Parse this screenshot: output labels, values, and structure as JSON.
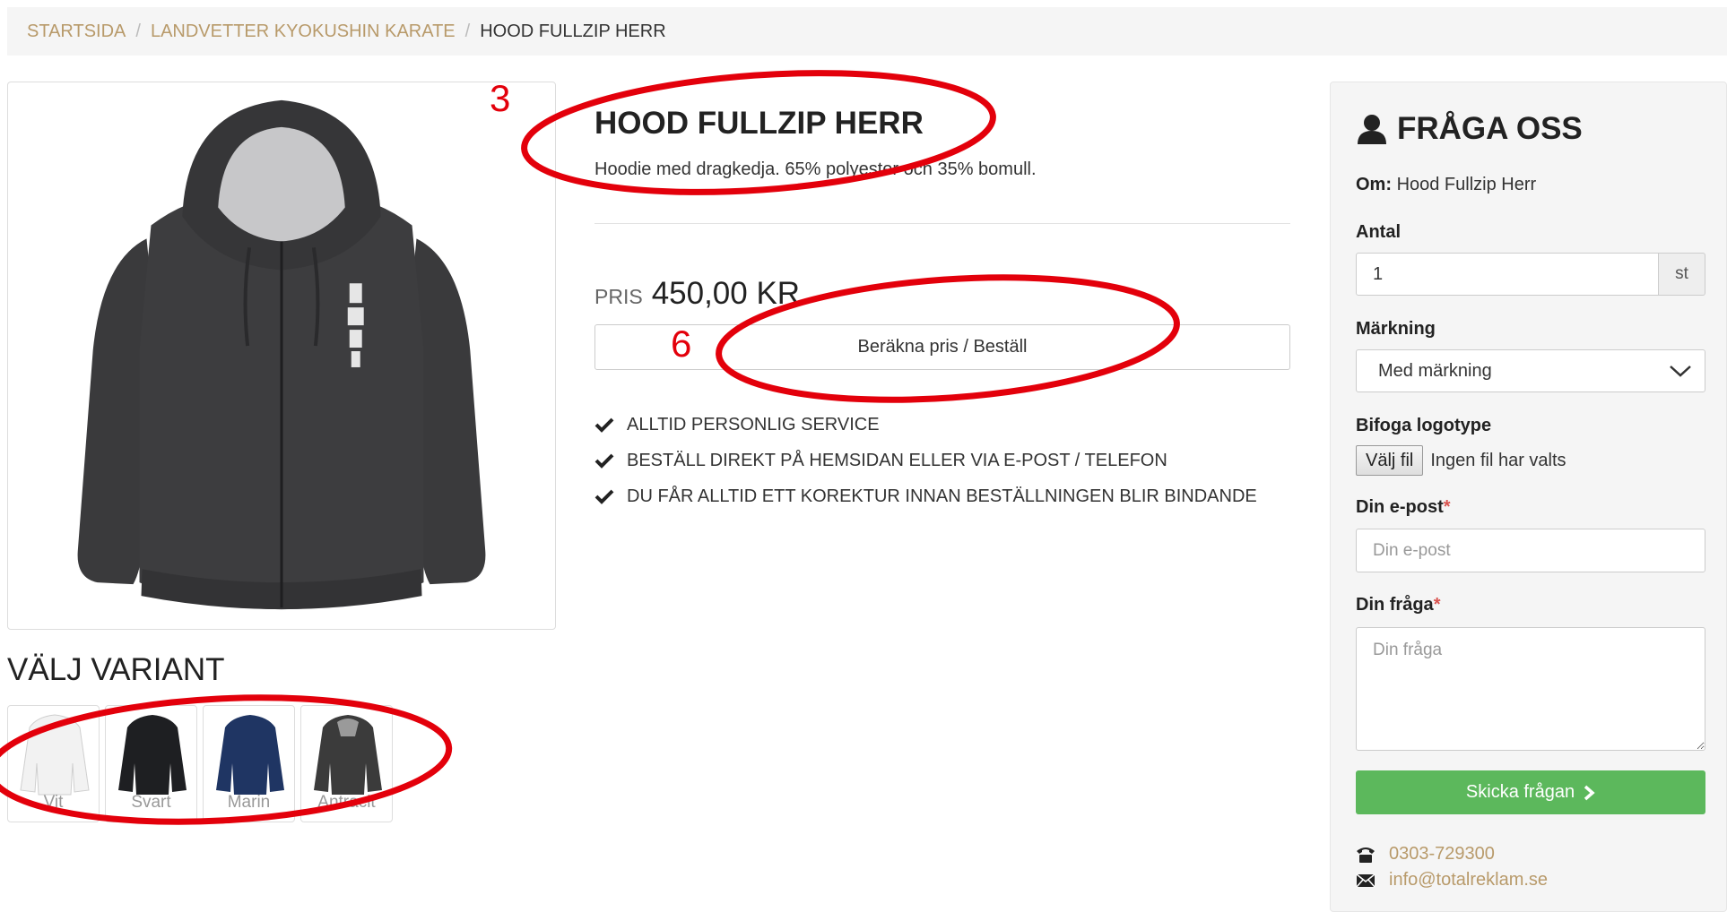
{
  "breadcrumb": {
    "items": [
      "STARTSIDA",
      "LANDVETTER KYOKUSHIN KARATE"
    ],
    "separator": "/",
    "current": "HOOD FULLZIP HERR"
  },
  "product": {
    "title": "HOOD FULLZIP HERR",
    "description": "Hoodie med dragkedja. 65% polyester och 35% bomull.",
    "price_label": "PRIS",
    "price_value": "450,00 KR",
    "order_button": "Beräkna pris / Beställ",
    "features": [
      "ALLTID PERSONLIG SERVICE",
      "BESTÄLL DIREKT PÅ HEMSIDAN ELLER VIA E-POST / TELEFON",
      "DU FÅR ALLTID ETT KOREKTUR INNAN BESTÄLLNINGEN BLIR BINDANDE"
    ],
    "image_color": "#3b3b3b"
  },
  "variants": {
    "heading": "VÄLJ VARIANT",
    "items": [
      {
        "label": "Vit",
        "color": "#f2f2f2"
      },
      {
        "label": "Svart",
        "color": "#1e1f22"
      },
      {
        "label": "Marin",
        "color": "#1f3563"
      },
      {
        "label": "Antracit",
        "color": "#3b3b3b"
      }
    ]
  },
  "ask": {
    "title": "FRÅGA OSS",
    "about_label": "Om:",
    "about_value": "Hood Fullzip Herr",
    "quantity_label": "Antal",
    "quantity_value": "1",
    "quantity_unit": "st",
    "marking_label": "Märkning",
    "marking_selected": "Med märkning",
    "logo_label": "Bifoga logotype",
    "file_button": "Välj fil",
    "file_status": "Ingen fil har valts",
    "email_label": "Din e-post",
    "email_placeholder": "Din e-post",
    "question_label": "Din fråga",
    "question_placeholder": "Din fråga",
    "required_mark": "*",
    "send_button": "Skicka frågan",
    "phone": "0303-729300",
    "email": "info@totalreklam.se"
  },
  "annotations": {
    "numbers": [
      "3",
      "6"
    ],
    "color": "#e3000b"
  },
  "colors": {
    "accent": "#b89a6a",
    "success": "#5cb85c",
    "required": "#d9534f"
  }
}
